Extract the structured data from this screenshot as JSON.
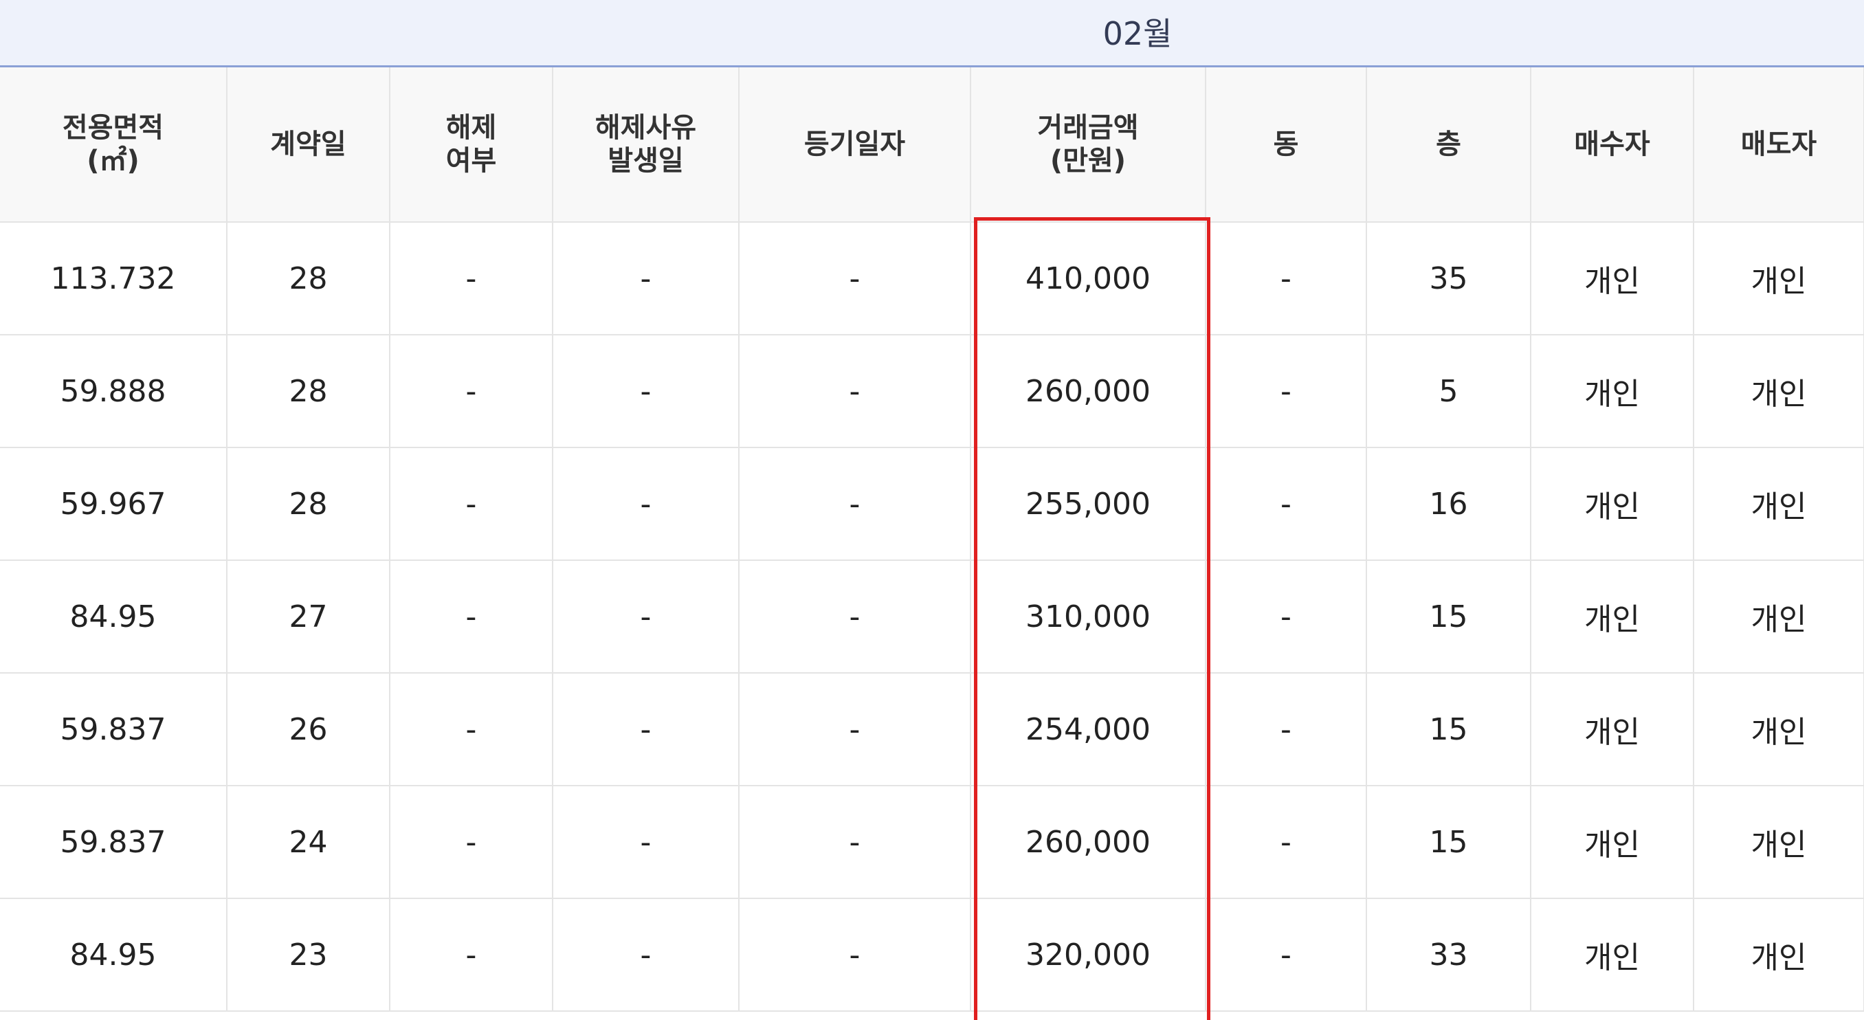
{
  "month": "02월",
  "columns": [
    "전용면적\n(㎡)",
    "계약일",
    "해제\n여부",
    "해제사유\n발생일",
    "등기일자",
    "거래금액\n(만원)",
    "동",
    "층",
    "매수자",
    "매도자"
  ],
  "rows": [
    [
      "113.732",
      "28",
      "-",
      "-",
      "-",
      "410,000",
      "-",
      "35",
      "개인",
      "개인"
    ],
    [
      "59.888",
      "28",
      "-",
      "-",
      "-",
      "260,000",
      "-",
      "5",
      "개인",
      "개인"
    ],
    [
      "59.967",
      "28",
      "-",
      "-",
      "-",
      "255,000",
      "-",
      "16",
      "개인",
      "개인"
    ],
    [
      "84.95",
      "27",
      "-",
      "-",
      "-",
      "310,000",
      "-",
      "15",
      "개인",
      "개인"
    ],
    [
      "59.837",
      "26",
      "-",
      "-",
      "-",
      "254,000",
      "-",
      "15",
      "개인",
      "개인"
    ],
    [
      "59.837",
      "24",
      "-",
      "-",
      "-",
      "260,000",
      "-",
      "15",
      "개인",
      "개인"
    ],
    [
      "84.95",
      "23",
      "-",
      "-",
      "-",
      "320,000",
      "-",
      "33",
      "개인",
      "개인"
    ]
  ],
  "colors": {
    "highlight_border": "#e02020",
    "month_bar_bg": "#eef2fb",
    "month_bar_line": "#8aa0d6",
    "header_bg": "#f8f8f8",
    "grid_line": "#e4e4e4"
  }
}
